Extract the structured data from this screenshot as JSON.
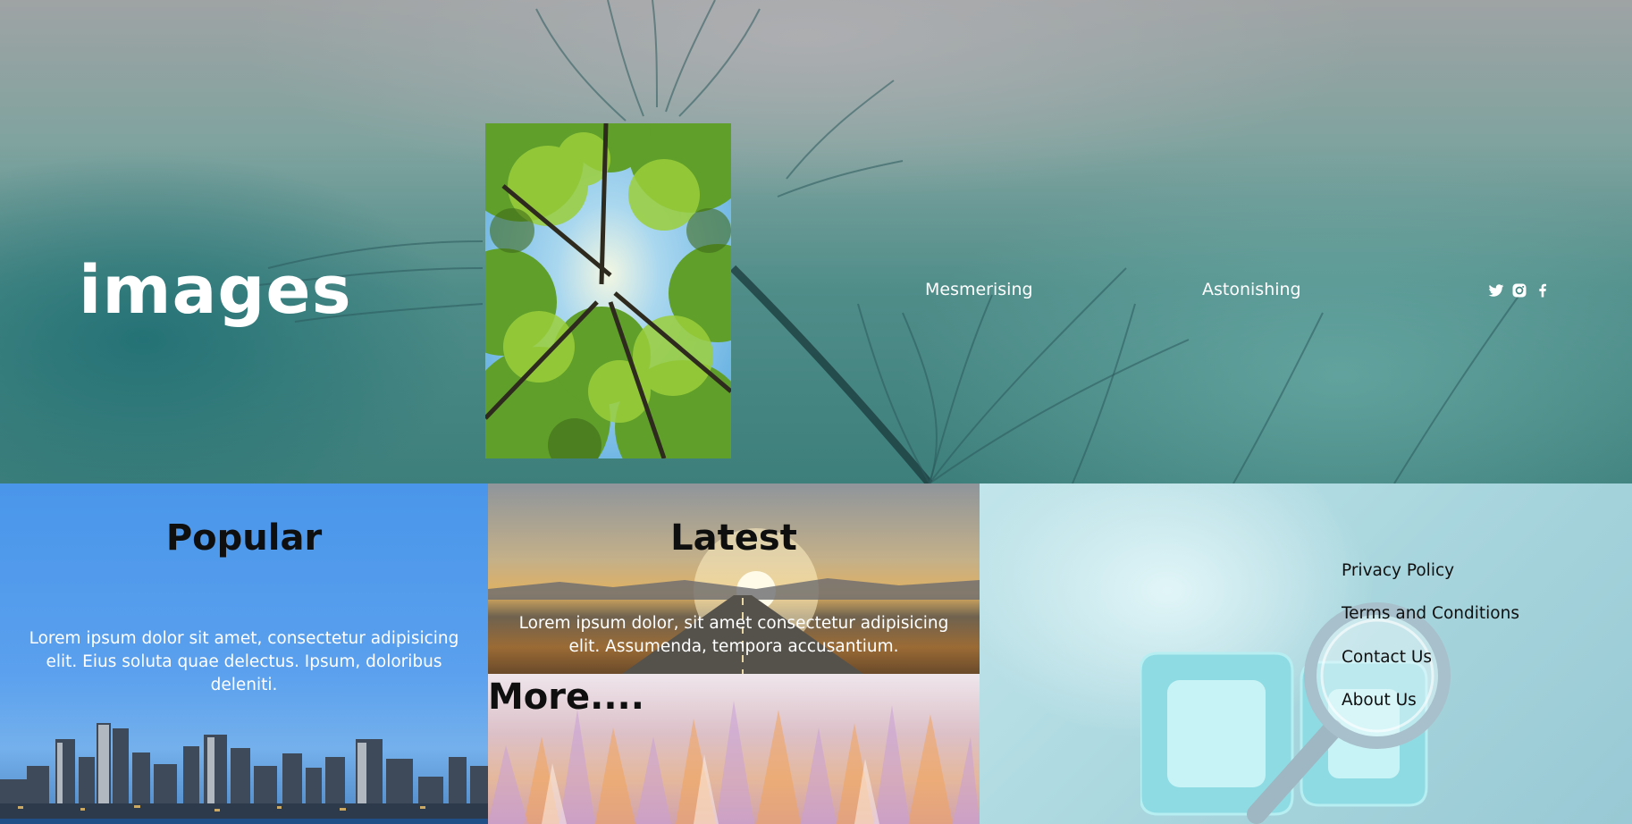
{
  "header": {
    "logo": "images",
    "nav": [
      {
        "label": "Mesmerising"
      },
      {
        "label": "Astonishing"
      }
    ],
    "social_icons": [
      "twitter-icon",
      "instagram-icon",
      "facebook-icon"
    ]
  },
  "sections": {
    "popular": {
      "title": "Popular",
      "text": "Lorem ipsum dolor sit amet, consectetur adipisicing elit. Eius soluta quae delectus. Ipsum, doloribus deleniti."
    },
    "latest": {
      "title": "Latest",
      "text": "Lorem ipsum dolor, sit amet consectetur adipisicing elit. Assumenda, tempora accusantium."
    },
    "more": {
      "title": "More...."
    }
  },
  "footer_links": [
    {
      "label": "Privacy Policy"
    },
    {
      "label": "Terms and Conditions"
    },
    {
      "label": "Contact Us"
    },
    {
      "label": "About Us"
    }
  ],
  "colors": {
    "hero_teal": "#3d7f7b",
    "popular_blue": "#4a96ea",
    "links_bg": "#a9d6de",
    "heading_text": "#0f0f0f",
    "light_text": "#ffffff"
  }
}
